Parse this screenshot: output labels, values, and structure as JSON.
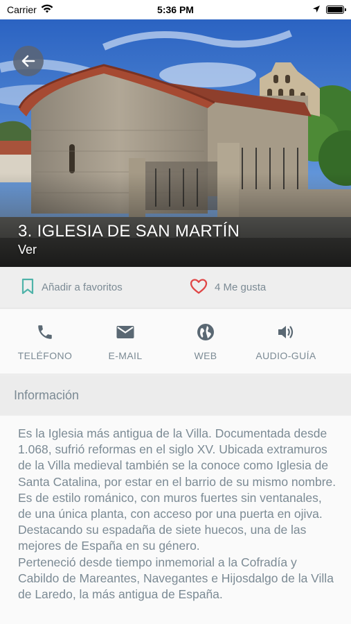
{
  "status_bar": {
    "carrier": "Carrier",
    "time": "5:36 PM"
  },
  "hero": {
    "title": "3. IGLESIA DE SAN MARTÍN",
    "subtitle": "Ver"
  },
  "actions": {
    "favorite_label": "Añadir a favoritos",
    "likes_label": "4 Me gusta"
  },
  "contacts": [
    {
      "label": "TELÉFONO",
      "icon": "phone-icon"
    },
    {
      "label": "E-MAIL",
      "icon": "mail-icon"
    },
    {
      "label": "WEB",
      "icon": "globe-icon"
    },
    {
      "label": "AUDIO-GUÍA",
      "icon": "speaker-icon"
    }
  ],
  "info": {
    "header": "Información",
    "paragraphs": [
      "Es la Iglesia más antigua de la Villa. Documentada desde 1.068, sufrió reformas en el siglo XV. Ubicada extramuros de la Villa medieval también se la conoce como Iglesia de Santa Catalina, por estar en el barrio de su mismo nombre.",
      "Es de estilo románico, con muros fuertes sin ventanales, de una única planta, con acceso por una puerta en ojiva. Destacando su espadaña de siete huecos, una de las mejores de España en su género.",
      "Perteneció desde tiempo inmemorial a la Cofradía y Cabildo de Mareantes, Navegantes e Hijosdalgo de la Villa de Laredo, la más antigua de España."
    ]
  },
  "colors": {
    "accent_teal": "#4fb3a9",
    "heart_red": "#e04646",
    "muted_text": "#7b8a94",
    "icon_slate": "#5a6873"
  }
}
